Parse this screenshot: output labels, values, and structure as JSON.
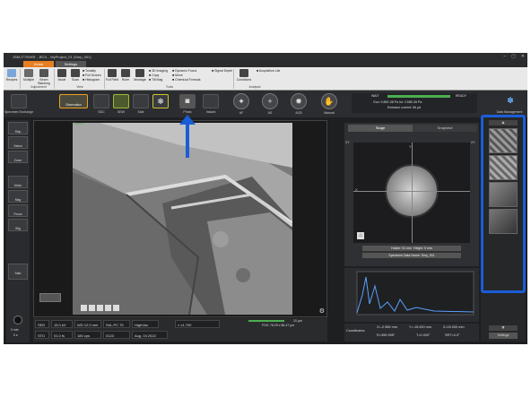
{
  "window": {
    "title": "JSM-IT700HR - JEOL - MyProject_01 (Smp_001)"
  },
  "tabs": {
    "home": "Home",
    "settings": "Settings"
  },
  "ribbon": {
    "recipes": "Recipes",
    "multiple_beam_blanking": "Multiple",
    "beam_blanking": "Beam Blanking",
    "mode": "Mode",
    "scan": "Scan",
    "tonality": "Tonality",
    "full_screen": "Full Screen",
    "histogram": "Histogram",
    "full_field_view": "Full Field",
    "ruler": "Ruler",
    "montage": "Montage",
    "imaging_3d": "3D Imaging",
    "copy": "Copy",
    "tilt_mag": "Tilt Mag",
    "dynamic_focus": "Dynamic Focus",
    "move": "Move",
    "chemical_formula": "Chemical Formula",
    "signal_depth": "Signal Depth",
    "conditions": "Conditions",
    "acquisition_list": "Acquisition List",
    "group_adjustment": "Adjustment",
    "group_view": "View",
    "group_tools": "Tools",
    "group_analysis": "Analysis"
  },
  "toolbar": {
    "specimen_exchange": "Specimen Exchange",
    "observation": "Observation",
    "sdc": "SDC",
    "sew": "SEW",
    "side": "Side",
    "photo": "Photo",
    "instant": "Instant",
    "af": "AF",
    "as": "AS",
    "acb": "ACB",
    "manual": "Manual",
    "wait": "WAIT",
    "ready": "READY",
    "gun": "Gun: 9.80E-08 Pa  Int: 3.56E-06 Pa",
    "emission": "Emission current: 66 μA",
    "data_management": "Data Management"
  },
  "left": {
    "stop": "Stop",
    "select": "Select",
    "zoom": "Zoom",
    "move": "Move",
    "mag": "Mag",
    "focus": "Focus",
    "stig": "Stig",
    "start": "Start",
    "time_min": "0 min",
    "time_s": "0 s"
  },
  "viewer": {
    "freeze": "Freeze"
  },
  "status": {
    "detector": "SED",
    "kv": "15.0 kV",
    "wd": "WD 12.0 mm",
    "std": "Std.-PC 75",
    "vac": "HighVac.",
    "mag": "x1,700",
    "scale": "10 μm",
    "fov": "FOV: 75.29 x 56.47 μm",
    "row2_a": "STD",
    "row2_b": "01.0 fs",
    "row2_c": "180 cps",
    "row2_d": "0123",
    "row2_e": "Aug. 04 2022"
  },
  "stage": {
    "tab_stage": "Stage",
    "tab_snapshot": "Snapshot",
    "holder": "Holder: 51 mm",
    "height": "Height: 5 mm",
    "specimen_name": "Specimen Data Name: Smp_001",
    "xy": "XY",
    "x": "X",
    "y": "Y"
  },
  "coords": {
    "label": "Coordinates",
    "x": "X=-2.966 mm",
    "y": "Y=-15.920 mm",
    "z": "Z=15.000 mm",
    "r": "R=359.998°",
    "t": "T=0.000°",
    "srt": "SRT=0.0°"
  },
  "thumbs": {
    "settings": "Settings"
  },
  "colors": {
    "highlight": "#1a5dd8",
    "accent": "#f0a020",
    "ready": "#4caf50"
  }
}
